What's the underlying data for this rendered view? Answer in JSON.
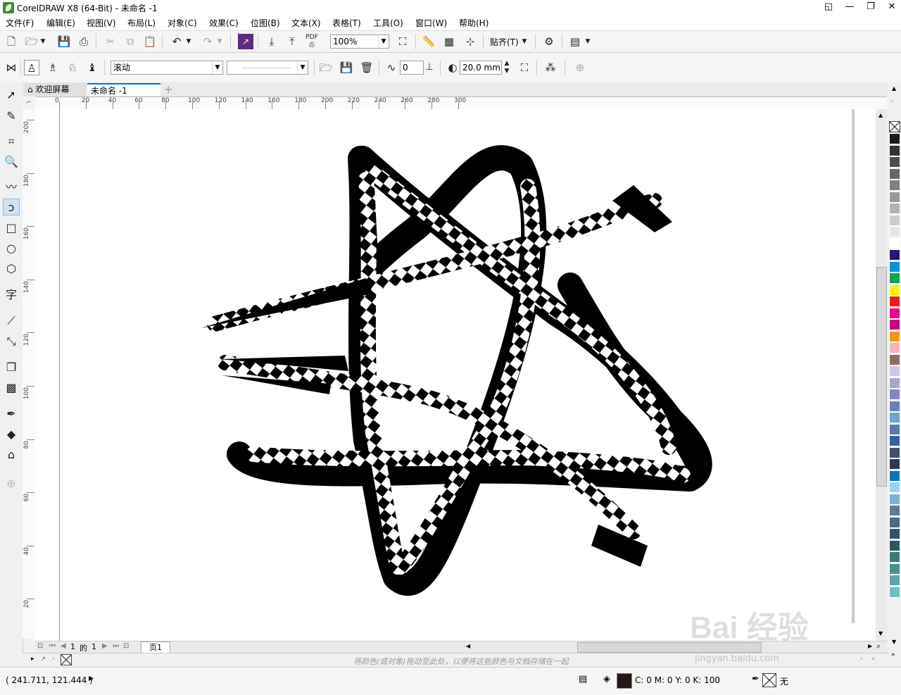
{
  "window": {
    "title": "CorelDRAW X8 (64-Bit) - 未命名 -1",
    "controls": [
      "◱",
      "—",
      "❐",
      "✕"
    ]
  },
  "menu": [
    "文件(F)",
    "编辑(E)",
    "视图(V)",
    "布局(L)",
    "对象(C)",
    "效果(C)",
    "位图(B)",
    "文本(X)",
    "表格(T)",
    "工具(O)",
    "窗口(W)",
    "帮助(H)"
  ],
  "standard_toolbar": {
    "zoom_value": "100%",
    "snap_label": "贴齐(T)"
  },
  "property_bar": {
    "mode_value": "滚动",
    "style_value": "",
    "angle_value": "0",
    "size_value": "20.0 mm"
  },
  "tabs": {
    "welcome": "欢迎屏幕",
    "document": "未命名 -1"
  },
  "rulers": {
    "horizontal": [
      "0",
      "20",
      "40",
      "60",
      "80",
      "100",
      "120",
      "140",
      "160",
      "180",
      "200",
      "220",
      "240",
      "260",
      "280",
      "300"
    ],
    "vertical": [
      "200",
      "180",
      "160",
      "140",
      "120",
      "100",
      "80",
      "60",
      "40",
      "20"
    ]
  },
  "page_nav": {
    "current": "1",
    "of_label": "的",
    "total": "1",
    "page_tab": "页1"
  },
  "colorbar_hint": "将颜色(或对象)拖动至此处，以便将这些颜色与文档存储在一起",
  "status": {
    "coordinates": "( 241.711, 121.444 )",
    "fill_info": "C: 0 M: 0 Y: 0 K: 100",
    "outline_info": "无"
  },
  "palette": [
    "#ffffff",
    "#1a1a1a",
    "#333333",
    "#4d4d4d",
    "#666666",
    "#808080",
    "#999999",
    "#b3b3b3",
    "#cccccc",
    "#e6e6e6",
    "#ffffff",
    "#1b1b7e",
    "#0096d6",
    "#00a651",
    "#fff200",
    "#ed1c24",
    "#ec008c",
    "#c7007d",
    "#f7941d",
    "#f4b6b9",
    "#8c6e63",
    "#c9c9e8",
    "#a7a7d6",
    "#8585c4",
    "#6e7cc0",
    "#6ea3d4",
    "#5a7ab0",
    "#3c5fa0",
    "#405070",
    "#2a3a5a",
    "#0077c0",
    "#a0d0f0",
    "#80b0d0",
    "#607890",
    "#4a6a80",
    "#35506a",
    "#2a5a5a",
    "#3a7a7a",
    "#4a9090",
    "#5aa8a8",
    "#6ac0c0"
  ],
  "watermark": {
    "brand": "Bai 经验",
    "url": "jingyan.baidu.com"
  }
}
